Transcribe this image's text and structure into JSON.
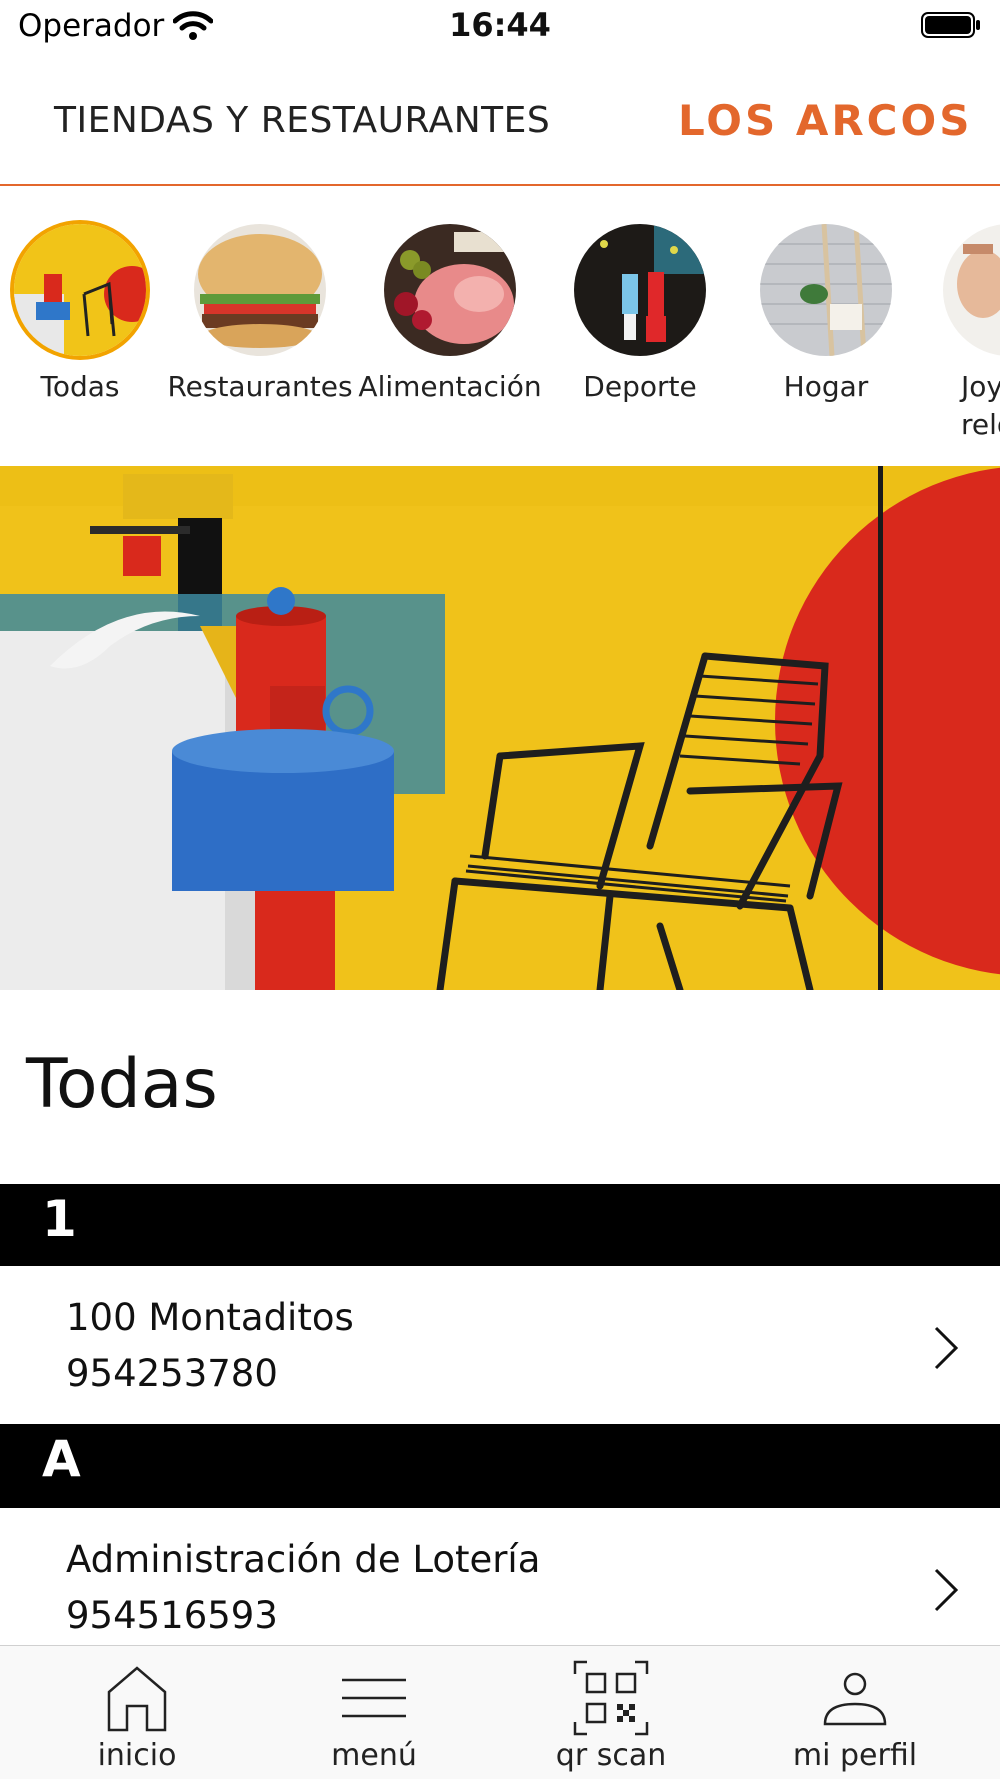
{
  "status_bar": {
    "carrier": "Operador",
    "time": "16:44"
  },
  "header": {
    "title": "TIENDAS Y RESTAURANTES",
    "brand": "LOS ARCOS",
    "accent_color": "#e3672c"
  },
  "categories": [
    {
      "label": "Todas",
      "active": true
    },
    {
      "label": "Restaurantes"
    },
    {
      "label": "Alimentación"
    },
    {
      "label": "Deporte"
    },
    {
      "label": "Hogar"
    },
    {
      "label": "Joy\nrelo"
    }
  ],
  "section": {
    "title": "Todas"
  },
  "list": [
    {
      "header": "1",
      "items": [
        {
          "name": "100 Montaditos",
          "phone": "954253780"
        }
      ]
    },
    {
      "header": "A",
      "items": [
        {
          "name": "Administración de Lotería",
          "phone": "954516593"
        }
      ]
    }
  ],
  "tabbar": [
    {
      "label": "inicio",
      "icon": "home-icon"
    },
    {
      "label": "menú",
      "icon": "menu-icon"
    },
    {
      "label": "qr scan",
      "icon": "qr-scan-icon"
    },
    {
      "label": "mi perfil",
      "icon": "profile-icon"
    }
  ]
}
